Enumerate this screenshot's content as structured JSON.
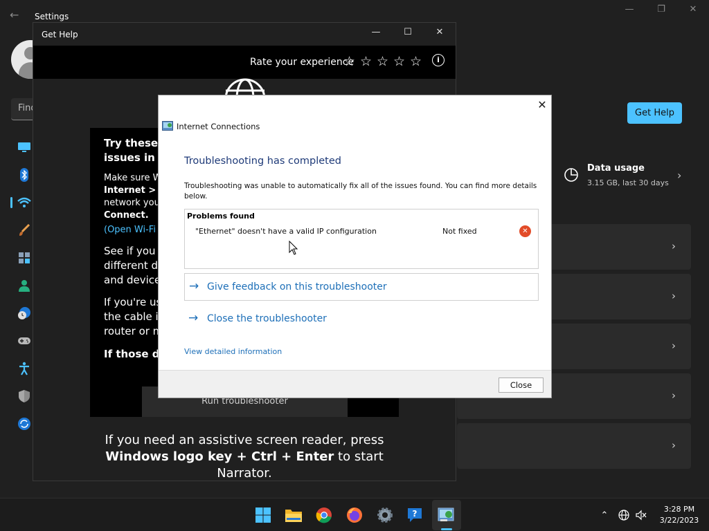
{
  "settings": {
    "title": "Settings",
    "search_placeholder": "Find",
    "get_help_label": "Get Help",
    "data_usage": {
      "title": "Data usage",
      "subtitle": "3.15 GB, last 30 days"
    }
  },
  "get_help_window": {
    "title": "Get Help",
    "rate_label": "Rate your experience",
    "heading": "Try these t\nissues in W",
    "para1_normal": "Make sure W",
    "para1_bold": "Internet > W",
    "para1_line3": "network you",
    "para1_bold2": "Connect.",
    "para1_link": "(Open Wi-Fi",
    "para2": "See if you c\ndifferent de\nand device,",
    "para3": "If you're us\nthe cable is\nrouter or m",
    "para4": "If those do",
    "run_button": "Run troubleshooter",
    "narrator_line1": "If you need an assistive screen reader, press",
    "narrator_bold": "Windows logo key + Ctrl + Enter",
    "narrator_after": " to start",
    "narrator_line3": "Narrator."
  },
  "dialog": {
    "app_title": "Internet Connections",
    "heading": "Troubleshooting has completed",
    "description": "Troubleshooting was unable to automatically fix all of the issues found. You can find more details below.",
    "problems_header": "Problems found",
    "problems": [
      {
        "issue": "\"Ethernet\" doesn't have a valid IP configuration",
        "status": "Not fixed",
        "status_icon": "error-icon",
        "status_color": "#e24b28"
      }
    ],
    "feedback_link": "Give feedback on this troubleshooter",
    "close_link": "Close the troubleshooter",
    "details_link": "View detailed information",
    "close_button": "Close"
  },
  "taskbar": {
    "apps": [
      "start-icon",
      "file-explorer-icon",
      "chrome-icon",
      "firefox-icon",
      "settings-icon",
      "get-help-icon",
      "network-troubleshooter-icon"
    ],
    "active_app": "network-troubleshooter-icon",
    "time": "3:28 PM",
    "date": "3/22/2023"
  },
  "colors": {
    "accent": "#4cc2ff",
    "link": "#1d6fb8",
    "heading": "#1e3a78",
    "error": "#e24b28"
  }
}
